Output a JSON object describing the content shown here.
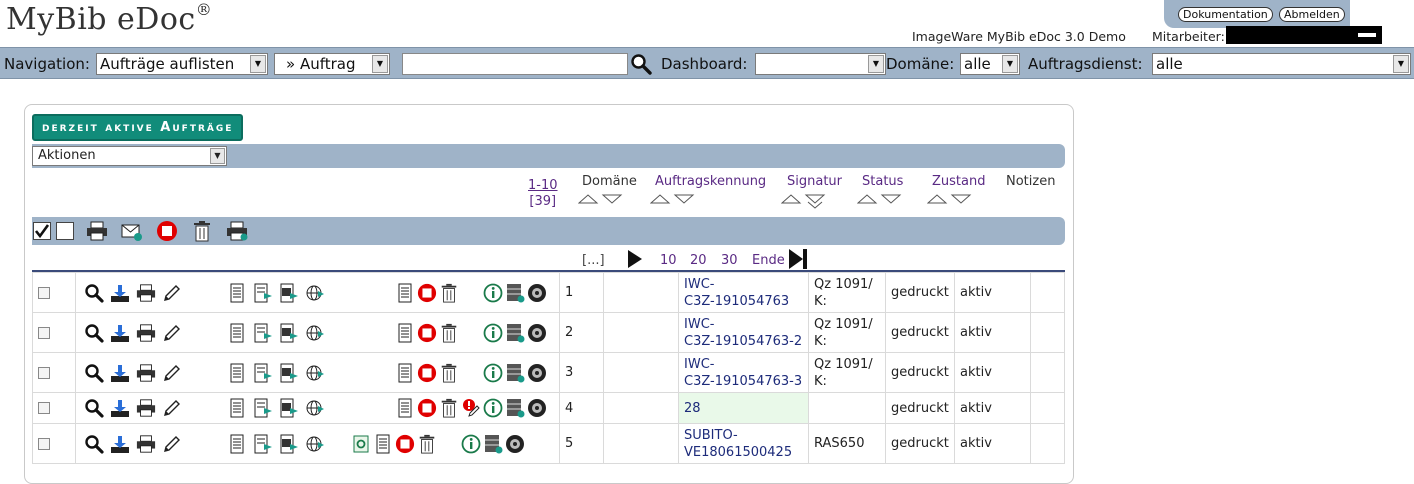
{
  "header": {
    "logo": "MyBib eDoc",
    "logo_mark": "®",
    "doc_button": "Dokumentation",
    "logout_button": "Abmelden",
    "demo_label": "ImageWare MyBib eDoc 3.0 Demo",
    "staff_label": "Mitarbeiter:"
  },
  "nav": {
    "navigation_label": "Navigation:",
    "navigation_value": "Aufträge auflisten",
    "order_value": "» Auftrag",
    "search_value": "",
    "dashboard_label": "Dashboard:",
    "dashboard_value": "",
    "domain_label": "Domäne:",
    "domain_value": "alle",
    "service_label": "Auftragsdienst:",
    "service_value": "alle"
  },
  "panel": {
    "title": "derzeit aktive Aufträge",
    "actions_value": "Aktionen",
    "range": "1-10",
    "total": "[39]",
    "columns": {
      "domain": "Domäne",
      "kennung": "Auftragskennung",
      "signatur": "Signatur",
      "status": "Status",
      "zustand": "Zustand",
      "notizen": "Notizen"
    },
    "pager": {
      "ellipsis": "[...]",
      "p10": "10",
      "p20": "20",
      "p30": "30",
      "end": "Ende"
    }
  },
  "rows": [
    {
      "num": "1",
      "kennung_1": "IWC-",
      "kennung_2": "C3Z-191054763",
      "sig_1": "Qz 1091/",
      "sig_2": "K:",
      "status": "gedruckt",
      "zustand": "aktiv"
    },
    {
      "num": "2",
      "kennung_1": "IWC-",
      "kennung_2": "C3Z-191054763-2",
      "sig_1": "Qz 1091/",
      "sig_2": "K:",
      "status": "gedruckt",
      "zustand": "aktiv"
    },
    {
      "num": "3",
      "kennung_1": "IWC-",
      "kennung_2": "C3Z-191054763-3",
      "sig_1": "Qz 1091/",
      "sig_2": "K:",
      "status": "gedruckt",
      "zustand": "aktiv"
    },
    {
      "num": "4",
      "kennung_1": "28",
      "kennung_2": "",
      "sig_1": "",
      "sig_2": "",
      "status": "gedruckt",
      "zustand": "aktiv"
    },
    {
      "num": "5",
      "kennung_1": "SUBITO-",
      "kennung_2": "VE18061500425",
      "sig_1": "RAS650",
      "sig_2": "",
      "status": "gedruckt",
      "zustand": "aktiv"
    }
  ],
  "colors": {
    "bar": "#9fb3c8",
    "title_badge": "#118c7a",
    "link": "#5a2a84",
    "kennung": "#1d2b7a",
    "stop_red": "#e00000"
  }
}
